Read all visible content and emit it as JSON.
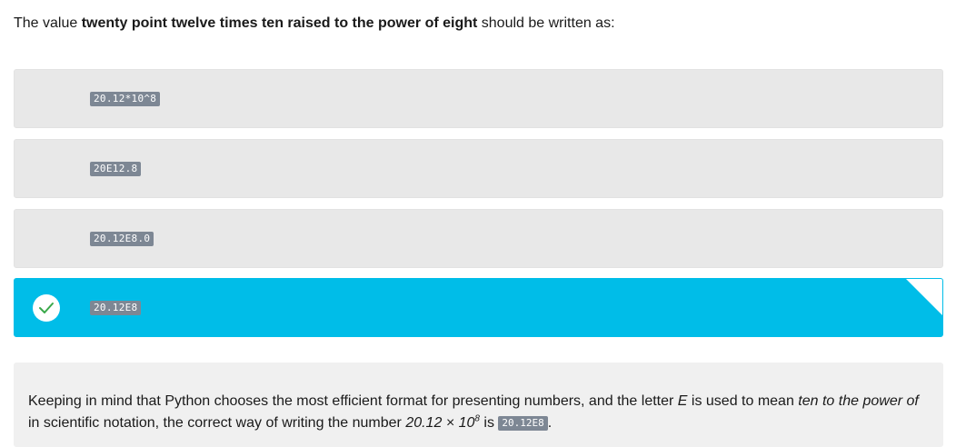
{
  "question": {
    "prefix": "The value ",
    "bold": "twenty point twelve times ten raised to the power of eight",
    "suffix": " should be written as:"
  },
  "options": [
    {
      "code": "20.12*10^8",
      "correct": false
    },
    {
      "code": "20E12.8",
      "correct": false
    },
    {
      "code": "20.12E8.0",
      "correct": false
    },
    {
      "code": "20.12E8",
      "correct": true
    }
  ],
  "explanation": {
    "part1": "Keeping in mind that Python chooses the most efficient format for presenting numbers, and the letter ",
    "letter": "E",
    "part2": " is used to mean ",
    "phrase": "ten to the power of",
    "part3": " in scientific notation, the correct way of writing the number ",
    "number_base": "20.12 × 10",
    "number_exp": "8",
    "part4": " is ",
    "answer_code": "20.12E8",
    "part5": "."
  },
  "colors": {
    "option_bg": "#e8e8e8",
    "correct_bg": "#00bde8",
    "code_pill_bg": "#7d8794",
    "check_green": "#3aa84a",
    "explanation_bg": "#f0f0f0"
  },
  "icons": {
    "check": "check-icon",
    "corner": "corner-flag"
  }
}
